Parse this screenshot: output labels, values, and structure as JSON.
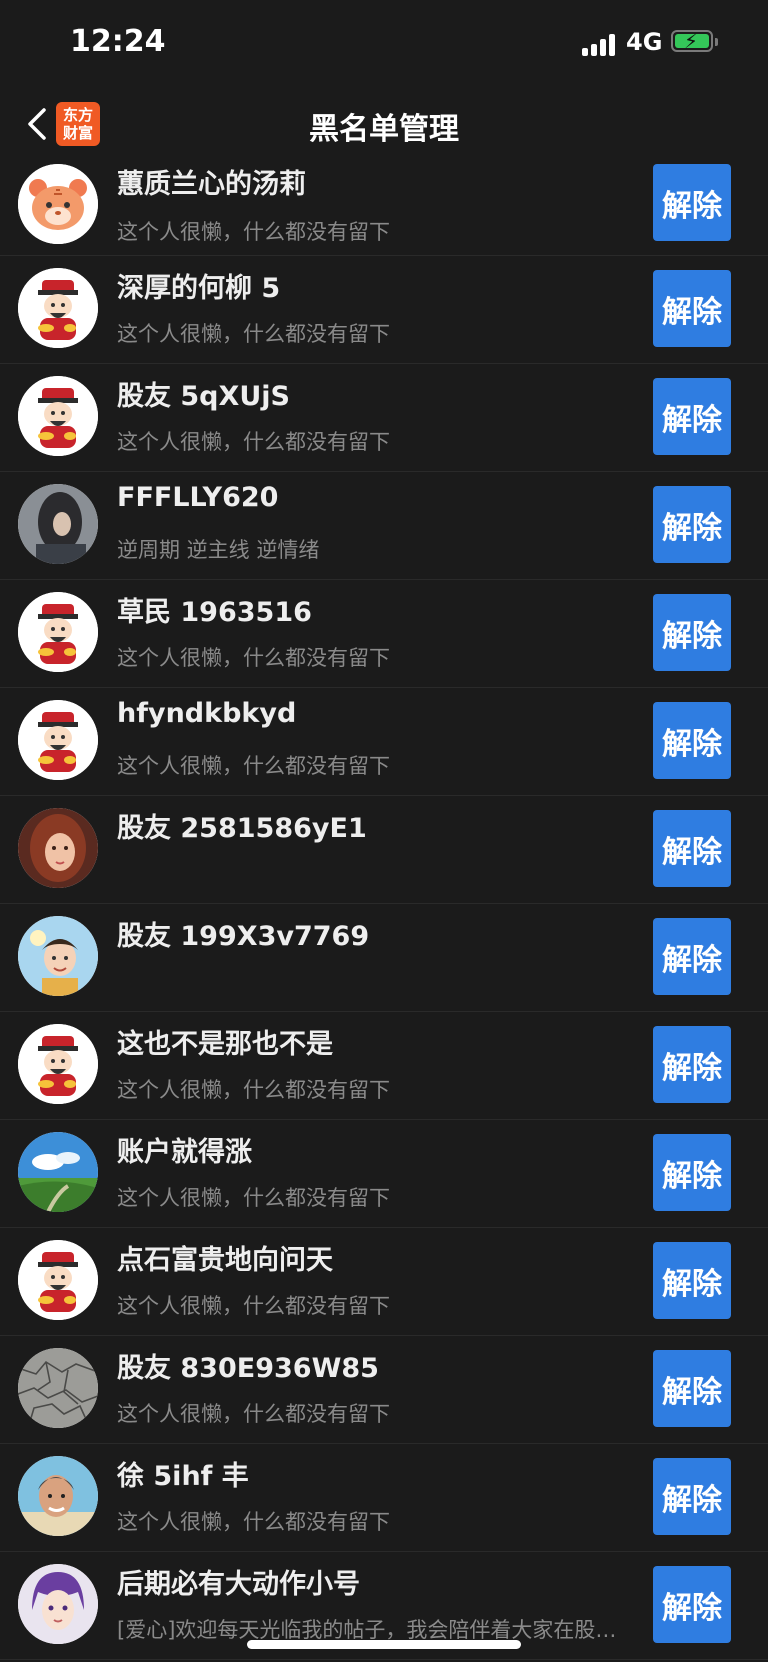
{
  "status_bar": {
    "time": "12:24",
    "network": "4G"
  },
  "nav": {
    "title": "黑名单管理",
    "logo_line1": "东方",
    "logo_line2": "财富"
  },
  "unblock_label": "解除",
  "users": [
    {
      "name": "蕙质兰心的汤莉",
      "bio": "这个人很懒，什么都没有留下",
      "avatar": "tiger-avatar"
    },
    {
      "name": "深厚的何柳 5",
      "bio": "这个人很懒，什么都没有留下",
      "avatar": "fortune-god-avatar"
    },
    {
      "name": "股友 5qXUjS",
      "bio": "这个人很懒，什么都没有留下",
      "avatar": "fortune-god-avatar"
    },
    {
      "name": "FFFLLY620",
      "bio": "逆周期 逆主线 逆情绪",
      "avatar": "photo-avatar"
    },
    {
      "name": "草民 1963516",
      "bio": "这个人很懒，什么都没有留下",
      "avatar": "fortune-god-avatar"
    },
    {
      "name": "hfyndkbkyd",
      "bio": "这个人很懒，什么都没有留下",
      "avatar": "fortune-god-avatar"
    },
    {
      "name": "股友 2581586yE1",
      "bio": "",
      "avatar": "portrait-avatar"
    },
    {
      "name": "股友 199X3v7769",
      "bio": "",
      "avatar": "cartoon-avatar"
    },
    {
      "name": "这也不是那也不是",
      "bio": "这个人很懒，什么都没有留下",
      "avatar": "fortune-god-avatar"
    },
    {
      "name": "账户就得涨",
      "bio": "这个人很懒，什么都没有留下",
      "avatar": "landscape-avatar"
    },
    {
      "name": "点石富贵地向问天",
      "bio": "这个人很懒，什么都没有留下",
      "avatar": "fortune-god-avatar"
    },
    {
      "name": "股友 830E936W85",
      "bio": "这个人很懒，什么都没有留下",
      "avatar": "texture-avatar"
    },
    {
      "name": "徐 5ihf 丰",
      "bio": "这个人很懒，什么都没有留下",
      "avatar": "man-avatar"
    },
    {
      "name": "后期必有大动作小号",
      "bio": "[爱心]欢迎每天光临我的帖子，我会陪伴着大家在股…",
      "avatar": "anime-avatar"
    }
  ]
}
